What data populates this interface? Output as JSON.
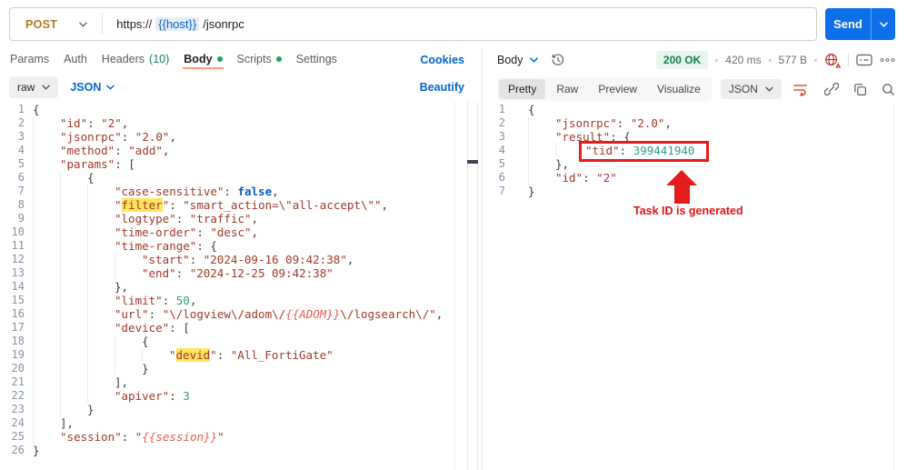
{
  "request_bar": {
    "method": "POST",
    "url_prefix": "https://",
    "url_variable": "{{host}}",
    "url_suffix": "/jsonrpc",
    "send_label": "Send"
  },
  "request_tabs": {
    "items": [
      {
        "label": "Params"
      },
      {
        "label": "Auth"
      },
      {
        "label": "Headers",
        "count": "(10)"
      },
      {
        "label": "Body",
        "dot": true,
        "active": true
      },
      {
        "label": "Scripts",
        "dot": true
      },
      {
        "label": "Settings"
      }
    ],
    "cookies_label": "Cookies"
  },
  "body_toolbar": {
    "mode": "raw",
    "language": "JSON",
    "beautify_label": "Beautify"
  },
  "request_editor": {
    "lines": [
      {
        "tokens": [
          [
            "pun",
            "{"
          ]
        ]
      },
      {
        "tokens": [
          [
            "ind",
            1
          ],
          [
            "red",
            "\"id\""
          ],
          [
            "pun",
            ": "
          ],
          [
            "red",
            "\"2\""
          ],
          [
            "pun",
            ","
          ]
        ]
      },
      {
        "tokens": [
          [
            "ind",
            1
          ],
          [
            "red",
            "\"jsonrpc\""
          ],
          [
            "pun",
            ": "
          ],
          [
            "red",
            "\"2.0\""
          ],
          [
            "pun",
            ","
          ]
        ]
      },
      {
        "tokens": [
          [
            "ind",
            1
          ],
          [
            "red",
            "\"method\""
          ],
          [
            "pun",
            ": "
          ],
          [
            "red",
            "\"add\""
          ],
          [
            "pun",
            ","
          ]
        ]
      },
      {
        "tokens": [
          [
            "ind",
            1
          ],
          [
            "red",
            "\"params\""
          ],
          [
            "pun",
            ": ["
          ]
        ]
      },
      {
        "tokens": [
          [
            "ind",
            2
          ],
          [
            "pun",
            "{"
          ]
        ]
      },
      {
        "tokens": [
          [
            "ind",
            3
          ],
          [
            "red",
            "\"case-sensitive\""
          ],
          [
            "pun",
            ": "
          ],
          [
            "bool",
            "false"
          ],
          [
            "pun",
            ","
          ]
        ]
      },
      {
        "tokens": [
          [
            "ind",
            3
          ],
          [
            "red",
            "\""
          ],
          [
            "hl",
            "filter"
          ],
          [
            "red",
            "\""
          ],
          [
            "pun",
            ": "
          ],
          [
            "red",
            "\"smart_action=\\\"all-accept\\\"\""
          ],
          [
            "pun",
            ","
          ]
        ]
      },
      {
        "tokens": [
          [
            "ind",
            3
          ],
          [
            "red",
            "\"logtype\""
          ],
          [
            "pun",
            ": "
          ],
          [
            "red",
            "\"traffic\""
          ],
          [
            "pun",
            ","
          ]
        ]
      },
      {
        "tokens": [
          [
            "ind",
            3
          ],
          [
            "red",
            "\"time-order\""
          ],
          [
            "pun",
            ": "
          ],
          [
            "red",
            "\"desc\""
          ],
          [
            "pun",
            ","
          ]
        ]
      },
      {
        "tokens": [
          [
            "ind",
            3
          ],
          [
            "red",
            "\"time-range\""
          ],
          [
            "pun",
            ": {"
          ]
        ]
      },
      {
        "tokens": [
          [
            "ind",
            4
          ],
          [
            "red",
            "\"start\""
          ],
          [
            "pun",
            ": "
          ],
          [
            "red",
            "\"2024-09-16 09:42:38\""
          ],
          [
            "pun",
            ","
          ]
        ]
      },
      {
        "tokens": [
          [
            "ind",
            4
          ],
          [
            "red",
            "\"end\""
          ],
          [
            "pun",
            ": "
          ],
          [
            "red",
            "\"2024-12-25 09:42:38\""
          ]
        ]
      },
      {
        "tokens": [
          [
            "ind",
            3
          ],
          [
            "pun",
            "},"
          ]
        ]
      },
      {
        "tokens": [
          [
            "ind",
            3
          ],
          [
            "red",
            "\"limit\""
          ],
          [
            "pun",
            ": "
          ],
          [
            "num",
            "50"
          ],
          [
            "pun",
            ","
          ]
        ]
      },
      {
        "tokens": [
          [
            "ind",
            3
          ],
          [
            "red",
            "\"url\""
          ],
          [
            "pun",
            ": "
          ],
          [
            "red",
            "\"\\/logview\\/adom\\/"
          ],
          [
            "var",
            "{{ADOM}}"
          ],
          [
            "red",
            "\\/logsearch\\/\""
          ],
          [
            "pun",
            ","
          ]
        ]
      },
      {
        "tokens": [
          [
            "ind",
            3
          ],
          [
            "red",
            "\"device\""
          ],
          [
            "pun",
            ": ["
          ]
        ]
      },
      {
        "tokens": [
          [
            "ind",
            4
          ],
          [
            "pun",
            "{"
          ]
        ]
      },
      {
        "tokens": [
          [
            "ind",
            5
          ],
          [
            "red",
            "\""
          ],
          [
            "hl",
            "devid"
          ],
          [
            "red",
            "\""
          ],
          [
            "pun",
            ": "
          ],
          [
            "red",
            "\"All_FortiGate\""
          ]
        ]
      },
      {
        "tokens": [
          [
            "ind",
            4
          ],
          [
            "pun",
            "}"
          ]
        ]
      },
      {
        "tokens": [
          [
            "ind",
            3
          ],
          [
            "pun",
            "],"
          ]
        ]
      },
      {
        "tokens": [
          [
            "ind",
            3
          ],
          [
            "red",
            "\"apiver\""
          ],
          [
            "pun",
            ": "
          ],
          [
            "num",
            "3"
          ]
        ]
      },
      {
        "tokens": [
          [
            "ind",
            2
          ],
          [
            "pun",
            "}"
          ]
        ]
      },
      {
        "tokens": [
          [
            "ind",
            1
          ],
          [
            "pun",
            "],"
          ]
        ]
      },
      {
        "tokens": [
          [
            "ind",
            1
          ],
          [
            "red",
            "\"session\""
          ],
          [
            "pun",
            ": "
          ],
          [
            "red",
            "\""
          ],
          [
            "var",
            "{{session}}"
          ],
          [
            "red",
            "\""
          ]
        ]
      },
      {
        "tokens": [
          [
            "pun",
            "}"
          ]
        ]
      }
    ]
  },
  "response": {
    "header": {
      "body_label": "Body",
      "status": "200 OK",
      "time": "420 ms",
      "size": "577 B"
    },
    "toolbar": {
      "views": [
        "Pretty",
        "Raw",
        "Preview",
        "Visualize"
      ],
      "active_view": "Pretty",
      "language": "JSON"
    },
    "editor": {
      "lines": [
        {
          "tokens": [
            [
              "pun",
              "{"
            ]
          ]
        },
        {
          "tokens": [
            [
              "ind",
              1
            ],
            [
              "red",
              "\"jsonrpc\""
            ],
            [
              "pun",
              ": "
            ],
            [
              "red",
              "\"2.0\""
            ],
            [
              "pun",
              ","
            ]
          ]
        },
        {
          "tokens": [
            [
              "ind",
              1
            ],
            [
              "red",
              "\"result\""
            ],
            [
              "pun",
              ": {"
            ]
          ]
        },
        {
          "tokens": [
            [
              "ind",
              2
            ],
            [
              "red",
              "\"tid\""
            ],
            [
              "pun",
              ": "
            ],
            [
              "num",
              "399441940"
            ]
          ],
          "boxed": true
        },
        {
          "tokens": [
            [
              "ind",
              1
            ],
            [
              "pun",
              "},"
            ]
          ]
        },
        {
          "tokens": [
            [
              "ind",
              1
            ],
            [
              "red",
              "\"id\""
            ],
            [
              "pun",
              ": "
            ],
            [
              "red",
              "\"2\""
            ]
          ]
        },
        {
          "tokens": [
            [
              "pun",
              "}"
            ]
          ]
        }
      ]
    },
    "annotation": {
      "label": "Task ID is generated"
    }
  },
  "icons": [
    "chevron-down-icon",
    "history-icon",
    "globe-warning-icon",
    "network-info-icon",
    "more-options-icon",
    "wrap-text-icon",
    "link-icon",
    "copy-icon",
    "search-icon"
  ],
  "colors": {
    "method_post": "#b7781d",
    "send_button": "#0d70ea",
    "link_accent": "#0265d2",
    "status_green": "#187c4a",
    "tab_underline": "#ff9d80",
    "highlight_yellow": "#ffe45e",
    "annotation_red": "#e51c1c"
  }
}
